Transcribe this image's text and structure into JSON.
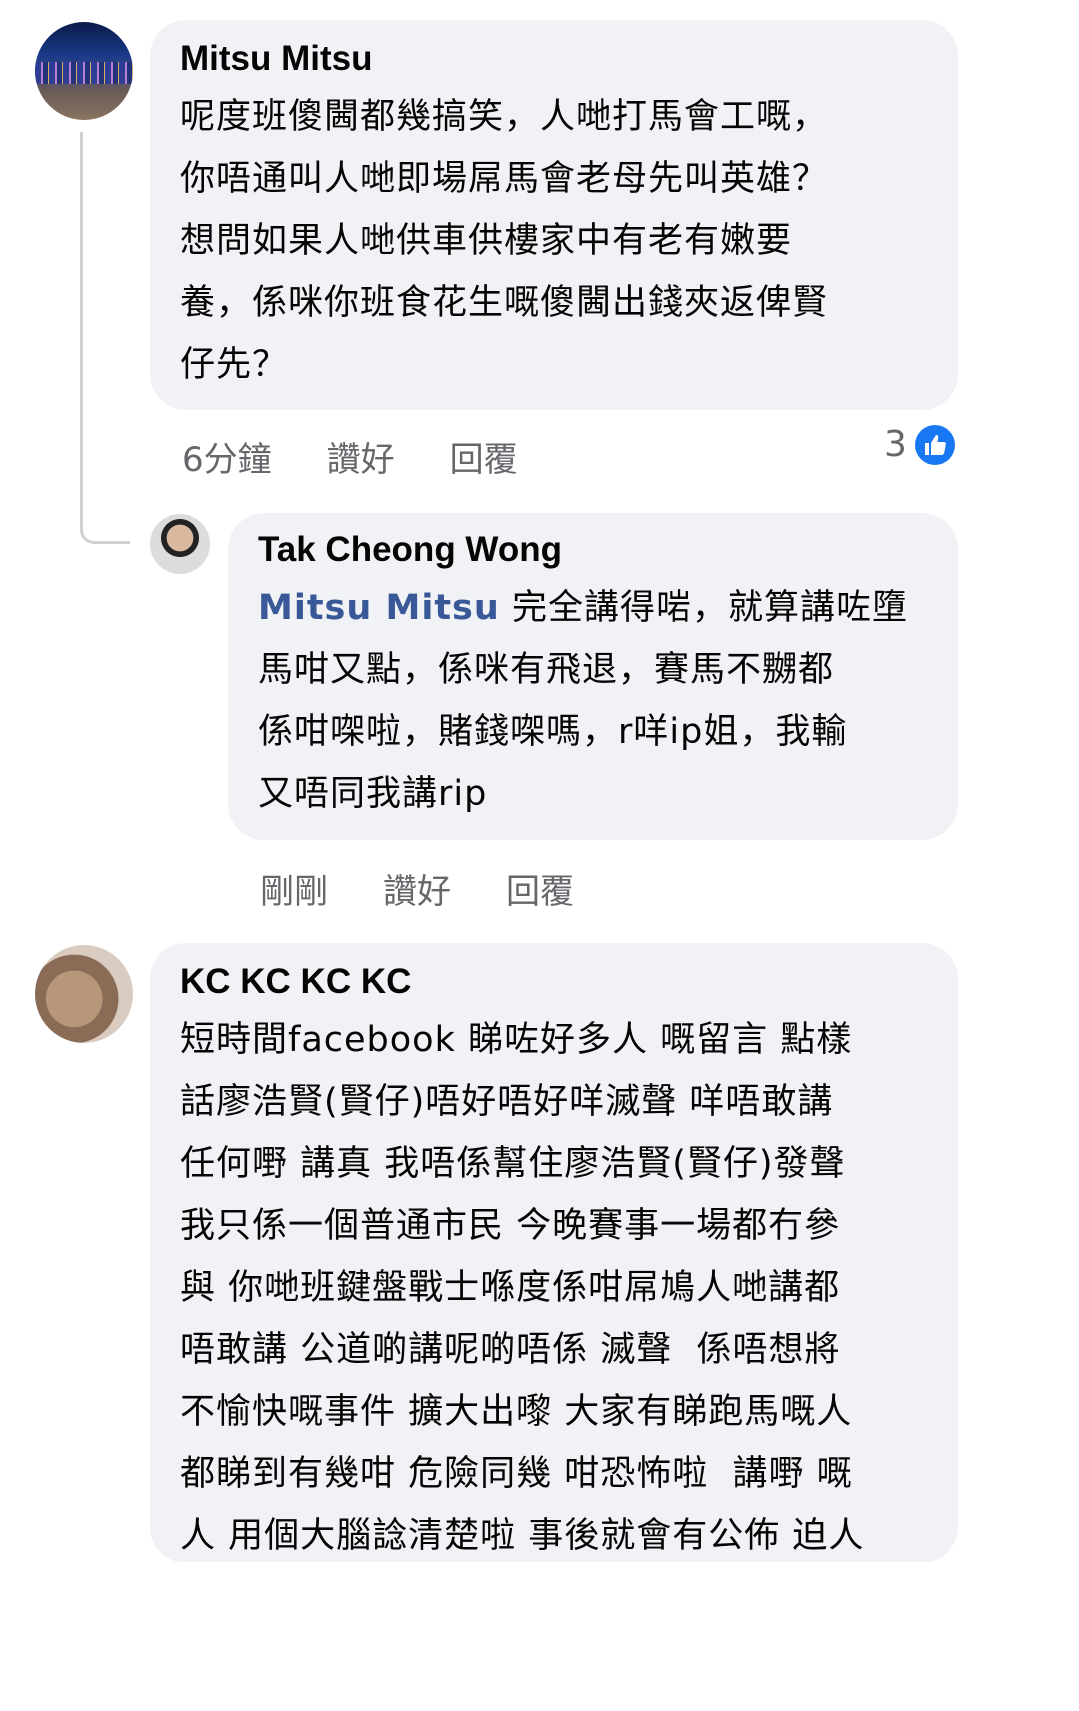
{
  "comments": [
    {
      "author": "Mitsu Mitsu",
      "lines": [
        "呢度班傻閪都幾搞笑，人哋打馬會工嘅，",
        "你唔通叫人哋即場屌馬會老母先叫英雄？",
        "想問如果人哋供車供樓家中有老有嫩要",
        "養，係咪你班食花生嘅傻閪出錢夾返俾賢",
        "仔先？"
      ],
      "time": "6分鐘",
      "like_label": "讚好",
      "reply_label": "回覆",
      "reaction_count": "3",
      "reaction_icon": "like-icon"
    },
    {
      "author": "Tak Cheong Wong",
      "mention": "Mitsu Mitsu",
      "first_line_rest": " 完全講得啱，就算講咗墮",
      "lines": [
        "馬咁又點，係咪有飛退，賽馬不嬲都",
        "係咁㗎啦，賭錢㗎嗎，r咩ip姐，我輸",
        "又唔同我講rip"
      ],
      "time": "剛剛",
      "like_label": "讚好",
      "reply_label": "回覆"
    },
    {
      "author": "KC KC KC KC",
      "lines": [
        "短時間facebook 睇咗好多人 嘅留言 點樣",
        "話廖浩賢(賢仔)唔好唔好咩滅聲 咩唔敢講",
        "任何嘢 講真 我唔係幫住廖浩賢(賢仔)發聲",
        "我只係一個普通市民 今晚賽事一場都冇參",
        "與 你哋班鍵盤戰士喺度係咁屌鳩人哋講都",
        "唔敢講 公道啲講呢啲唔係 滅聲  係唔想將",
        "不愉快嘅事件 擴大出嚟 大家有睇跑馬嘅人",
        "都睇到有幾咁 危險同幾 咁恐怖啦  講嘢 嘅",
        "人 用個大腦諗清楚啦 事後就會有公佈 迫人"
      ]
    }
  ],
  "colors": {
    "bubble": "#f0f2f5",
    "mention": "#385898",
    "meta": "#65676b",
    "like": "#1877f2"
  }
}
